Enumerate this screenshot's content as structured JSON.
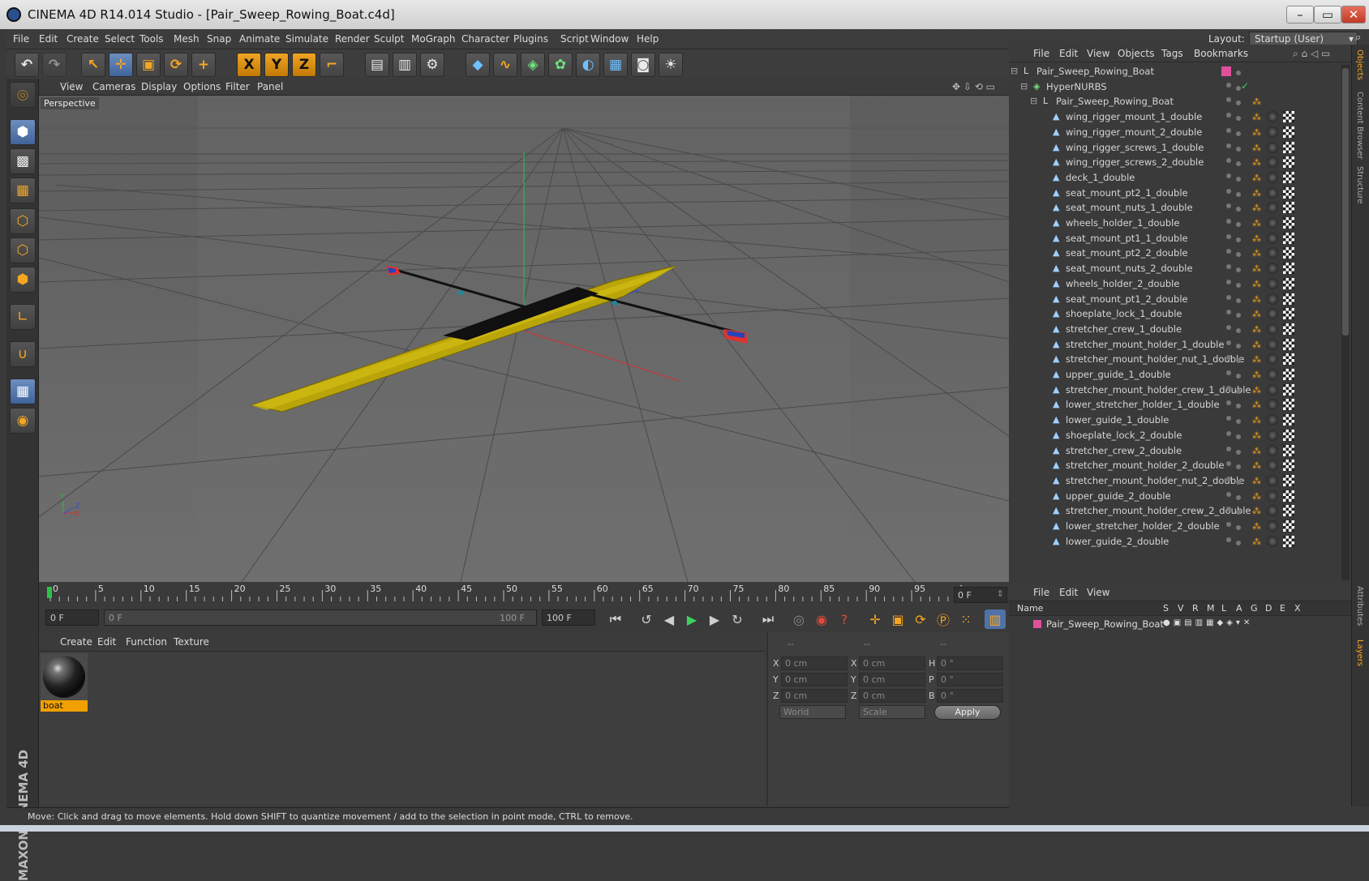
{
  "window": {
    "title": "CINEMA 4D R14.014 Studio - [Pair_Sweep_Rowing_Boat.c4d]",
    "controls": [
      "–",
      "▭",
      "✕"
    ]
  },
  "menubar": {
    "items": [
      "File",
      "Edit",
      "Create",
      "Select",
      "Tools",
      "Mesh",
      "Snap",
      "Animate",
      "Simulate",
      "Render",
      "Sculpt",
      "MoGraph",
      "Character",
      "Plugins",
      "Script",
      "Window",
      "Help"
    ],
    "layout_label": "Layout:",
    "layout_value": "Startup (User)"
  },
  "toolbar": {
    "icons": [
      "undo-icon",
      "redo-icon",
      "live-selection-icon",
      "move-icon",
      "scale-icon",
      "rotate-icon",
      "add-icon",
      "x-axis-icon",
      "y-axis-icon",
      "z-axis-icon",
      "coordinate-system-icon",
      "render-view-icon",
      "render-picture-viewer-icon",
      "render-settings-icon",
      "cube-icon",
      "spline-icon",
      "nurbs-icon",
      "array-icon",
      "deformer-icon",
      "scene-floor-icon",
      "camera-icon",
      "light-icon"
    ]
  },
  "viewport": {
    "menu": [
      "View",
      "Cameras",
      "Display",
      "Options",
      "Filter",
      "Panel"
    ],
    "label": "Perspective",
    "axis_labels": {
      "y": "Y",
      "z": "Z",
      "x": "X"
    }
  },
  "timeline": {
    "ticks": [
      "0",
      "5",
      "10",
      "15",
      "20",
      "25",
      "30",
      "35",
      "40",
      "45",
      "50",
      "55",
      "60",
      "65",
      "70",
      "75",
      "80",
      "85",
      "90",
      "95",
      "100"
    ],
    "current_frame": "0 F",
    "start_frame": "0 F",
    "range_start": "0 F",
    "range_end": "100 F",
    "end_frame": "100 F"
  },
  "material_manager": {
    "menu": [
      "Create",
      "Edit",
      "Function",
      "Texture"
    ],
    "materials": [
      {
        "name": "boat"
      }
    ]
  },
  "coordinates": {
    "headers": [
      "--",
      "--",
      "--"
    ],
    "rows": [
      {
        "l1": "X",
        "v1": "0 cm",
        "l2": "X",
        "v2": "0 cm",
        "l3": "H",
        "v3": "0 °"
      },
      {
        "l1": "Y",
        "v1": "0 cm",
        "l2": "Y",
        "v2": "0 cm",
        "l3": "P",
        "v3": "0 °"
      },
      {
        "l1": "Z",
        "v1": "0 cm",
        "l2": "Z",
        "v2": "0 cm",
        "l3": "B",
        "v3": "0 °"
      }
    ],
    "mode1": "World",
    "mode2": "Scale",
    "apply": "Apply"
  },
  "object_manager": {
    "menu": [
      "File",
      "Edit",
      "View",
      "Objects",
      "Tags",
      "Bookmarks"
    ],
    "objects": [
      {
        "name": "Pair_Sweep_Rowing_Boat",
        "level": 0,
        "kind": "null"
      },
      {
        "name": "HyperNURBS",
        "level": 1,
        "kind": "nurbs"
      },
      {
        "name": "Pair_Sweep_Rowing_Boat",
        "level": 2,
        "kind": "null"
      },
      {
        "name": "wing_rigger_mount_1_double",
        "level": 3,
        "kind": "poly"
      },
      {
        "name": "wing_rigger_mount_2_double",
        "level": 3,
        "kind": "poly"
      },
      {
        "name": "wing_rigger_screws_1_double",
        "level": 3,
        "kind": "poly"
      },
      {
        "name": "wing_rigger_screws_2_double",
        "level": 3,
        "kind": "poly"
      },
      {
        "name": "deck_1_double",
        "level": 3,
        "kind": "poly"
      },
      {
        "name": "seat_mount_pt2_1_double",
        "level": 3,
        "kind": "poly"
      },
      {
        "name": "seat_mount_nuts_1_double",
        "level": 3,
        "kind": "poly"
      },
      {
        "name": "wheels_holder_1_double",
        "level": 3,
        "kind": "poly"
      },
      {
        "name": "seat_mount_pt1_1_double",
        "level": 3,
        "kind": "poly"
      },
      {
        "name": "seat_mount_pt2_2_double",
        "level": 3,
        "kind": "poly"
      },
      {
        "name": "seat_mount_nuts_2_double",
        "level": 3,
        "kind": "poly"
      },
      {
        "name": "wheels_holder_2_double",
        "level": 3,
        "kind": "poly"
      },
      {
        "name": "seat_mount_pt1_2_double",
        "level": 3,
        "kind": "poly"
      },
      {
        "name": "shoeplate_lock_1_double",
        "level": 3,
        "kind": "poly"
      },
      {
        "name": "stretcher_crew_1_double",
        "level": 3,
        "kind": "poly"
      },
      {
        "name": "stretcher_mount_holder_1_double",
        "level": 3,
        "kind": "poly"
      },
      {
        "name": "stretcher_mount_holder_nut_1_double",
        "level": 3,
        "kind": "poly"
      },
      {
        "name": "upper_guide_1_double",
        "level": 3,
        "kind": "poly"
      },
      {
        "name": "stretcher_mount_holder_crew_1_double",
        "level": 3,
        "kind": "poly"
      },
      {
        "name": "lower_stretcher_holder_1_double",
        "level": 3,
        "kind": "poly"
      },
      {
        "name": "lower_guide_1_double",
        "level": 3,
        "kind": "poly"
      },
      {
        "name": "shoeplate_lock_2_double",
        "level": 3,
        "kind": "poly"
      },
      {
        "name": "stretcher_crew_2_double",
        "level": 3,
        "kind": "poly"
      },
      {
        "name": "stretcher_mount_holder_2_double",
        "level": 3,
        "kind": "poly"
      },
      {
        "name": "stretcher_mount_holder_nut_2_double",
        "level": 3,
        "kind": "poly"
      },
      {
        "name": "upper_guide_2_double",
        "level": 3,
        "kind": "poly"
      },
      {
        "name": "stretcher_mount_holder_crew_2_double",
        "level": 3,
        "kind": "poly"
      },
      {
        "name": "lower_stretcher_holder_2_double",
        "level": 3,
        "kind": "poly"
      },
      {
        "name": "lower_guide_2_double",
        "level": 3,
        "kind": "poly"
      }
    ]
  },
  "side_tabs": [
    "Objects",
    "Content Browser",
    "Structure",
    "Attributes",
    "Layers"
  ],
  "layer_manager": {
    "menu": [
      "File",
      "Edit",
      "View"
    ],
    "columns": [
      "Name",
      "S",
      "V",
      "R",
      "M",
      "L",
      "A",
      "G",
      "D",
      "E",
      "X"
    ],
    "layers": [
      {
        "name": "Pair_Sweep_Rowing_Boat",
        "color": "#e0509a"
      }
    ]
  },
  "status": "Move: Click and drag to move elements. Hold down SHIFT to quantize movement / add to the selection in point mode, CTRL to remove.",
  "colors": {
    "accent": "#f5a623",
    "boat_hull": "#b9a40a",
    "selection_blue": "#4f73a8"
  }
}
